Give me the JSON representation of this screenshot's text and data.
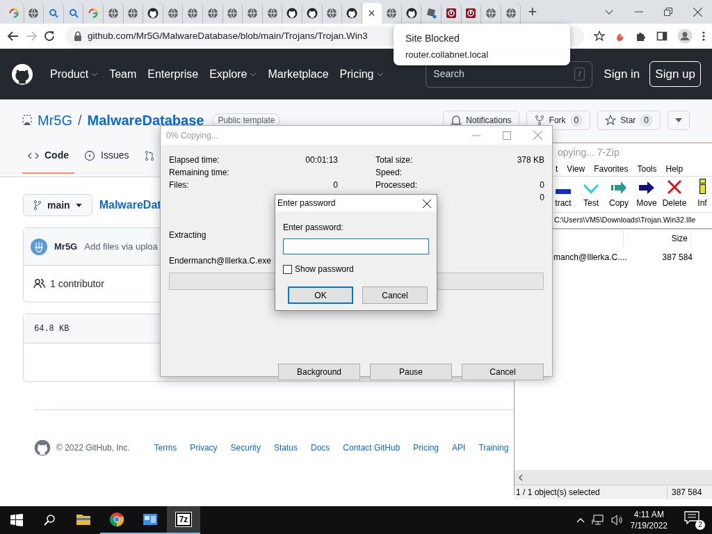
{
  "browser": {
    "tabs": [
      {
        "kind": "google",
        "selected": false
      },
      {
        "kind": "globe",
        "selected": false
      },
      {
        "kind": "search",
        "selected": false
      },
      {
        "kind": "search",
        "selected": false
      },
      {
        "kind": "google",
        "selected": false
      },
      {
        "kind": "globe",
        "selected": false
      },
      {
        "kind": "globe",
        "selected": false
      },
      {
        "kind": "github",
        "selected": false
      },
      {
        "kind": "globe",
        "selected": false
      },
      {
        "kind": "globe",
        "selected": false
      },
      {
        "kind": "globe",
        "selected": false
      },
      {
        "kind": "globe",
        "selected": false
      },
      {
        "kind": "globe",
        "selected": false
      },
      {
        "kind": "globe",
        "selected": false
      },
      {
        "kind": "github",
        "selected": false
      },
      {
        "kind": "github",
        "selected": false
      },
      {
        "kind": "globe",
        "selected": false
      },
      {
        "kind": "github",
        "selected": false
      },
      {
        "kind": "close",
        "selected": true,
        "label": "×"
      },
      {
        "kind": "globe",
        "selected": false
      },
      {
        "kind": "github",
        "selected": false
      },
      {
        "kind": "game",
        "selected": false
      },
      {
        "kind": "shield",
        "selected": false
      },
      {
        "kind": "shield",
        "selected": false
      },
      {
        "kind": "globe",
        "selected": false
      },
      {
        "kind": "globe",
        "selected": false
      }
    ],
    "new_tab": "+",
    "url": "github.com/Mr5G/MalwareDatabase/blob/main/Trojans/Trojan.Win3",
    "popup": {
      "title": "Site Blocked",
      "text": "router.collabnet.local"
    }
  },
  "github": {
    "nav": [
      {
        "label": "Product",
        "dropdown": true
      },
      {
        "label": "Team",
        "dropdown": false
      },
      {
        "label": "Enterprise",
        "dropdown": false
      },
      {
        "label": "Explore",
        "dropdown": true
      },
      {
        "label": "Marketplace",
        "dropdown": false
      },
      {
        "label": "Pricing",
        "dropdown": true
      }
    ],
    "search": {
      "placeholder": "Search",
      "key": "/"
    },
    "sign_in": "Sign in",
    "sign_up": "Sign up",
    "owner": "Mr5G",
    "separator": "/",
    "repo": "MalwareDatabase",
    "visibility": "Public template",
    "actions": [
      {
        "kind": "bell",
        "label": "Notifications"
      },
      {
        "kind": "fork",
        "label": "Fork",
        "count": "0"
      },
      {
        "kind": "star",
        "label": "Star",
        "count": "0"
      }
    ],
    "repo_tabs": [
      {
        "kind": "code",
        "label": "Code",
        "selected": true
      },
      {
        "kind": "issue",
        "label": "Issues",
        "selected": false
      },
      {
        "kind": "pull",
        "selected": false
      }
    ],
    "branch": "main",
    "breadcrumb": "MalwareDat",
    "commit": {
      "author": "Mr5G",
      "message": "Add files via uploa"
    },
    "contributors": "1 contributor",
    "file_size": "64.8 KB",
    "footer": {
      "copyright": "© 2022 GitHub, Inc.",
      "links": [
        "Terms",
        "Privacy",
        "Security",
        "Status",
        "Docs",
        "Contact GitHub",
        "Pricing",
        "API",
        "Training"
      ]
    }
  },
  "copy_dialog": {
    "title": "0% Copying...",
    "stats_left": [
      {
        "label": "Elapsed time:",
        "value": "00:01:13"
      },
      {
        "label": "Remaining time:"
      },
      {
        "label": "Files:",
        "value": "0"
      }
    ],
    "stats_right": [
      {
        "label": "Total size:",
        "value": "378 KB"
      },
      {
        "label": "Speed:"
      },
      {
        "label": "Processed:",
        "value": "0"
      },
      {
        "value": "0"
      }
    ],
    "operation": "Extracting",
    "current_file": "Endermanch@Illerka.C.exe",
    "progress": {
      "level": 0
    },
    "buttons": [
      "Background",
      "Pause",
      "Cancel"
    ]
  },
  "password_dialog": {
    "title": "Enter password",
    "label": "Enter password:",
    "show_password": {
      "label": "Show password",
      "checked": false
    },
    "buttons": [
      {
        "label": "OK",
        "default": true
      },
      {
        "label": "Cancel",
        "default": false
      }
    ]
  },
  "sevenzip": {
    "title": "opying... 7-Zip",
    "menu": [
      "t",
      "View",
      "Favorites",
      "Tools",
      "Help"
    ],
    "tools": [
      {
        "kind": "extract",
        "label": "tract"
      },
      {
        "kind": "test",
        "label": "Test"
      },
      {
        "kind": "copy",
        "label": "Copy"
      },
      {
        "kind": "move",
        "label": "Move"
      },
      {
        "kind": "delete",
        "label": "Delete"
      },
      {
        "kind": "info",
        "label": "Inf"
      }
    ],
    "path": "C:\\Users\\VM5\\Downloads\\Trojan.Win32.Ille",
    "columns": [
      "Size"
    ],
    "rows": [
      {
        "name": "manch@Illerka.C....",
        "size": "387 584"
      }
    ],
    "status": [
      "1 / 1 object(s) selected",
      "387 584"
    ]
  },
  "taskbar": {
    "apps": [
      {
        "kind": "explorer",
        "running": false,
        "selected": false
      },
      {
        "kind": "chrome",
        "running": true,
        "selected": false
      },
      {
        "kind": "app",
        "running": true,
        "selected": false
      },
      {
        "kind": "sevenzip",
        "label": "7z",
        "running": true,
        "selected": true
      }
    ],
    "time": "4:11 AM",
    "date": "7/19/2022",
    "notifications": "2"
  }
}
